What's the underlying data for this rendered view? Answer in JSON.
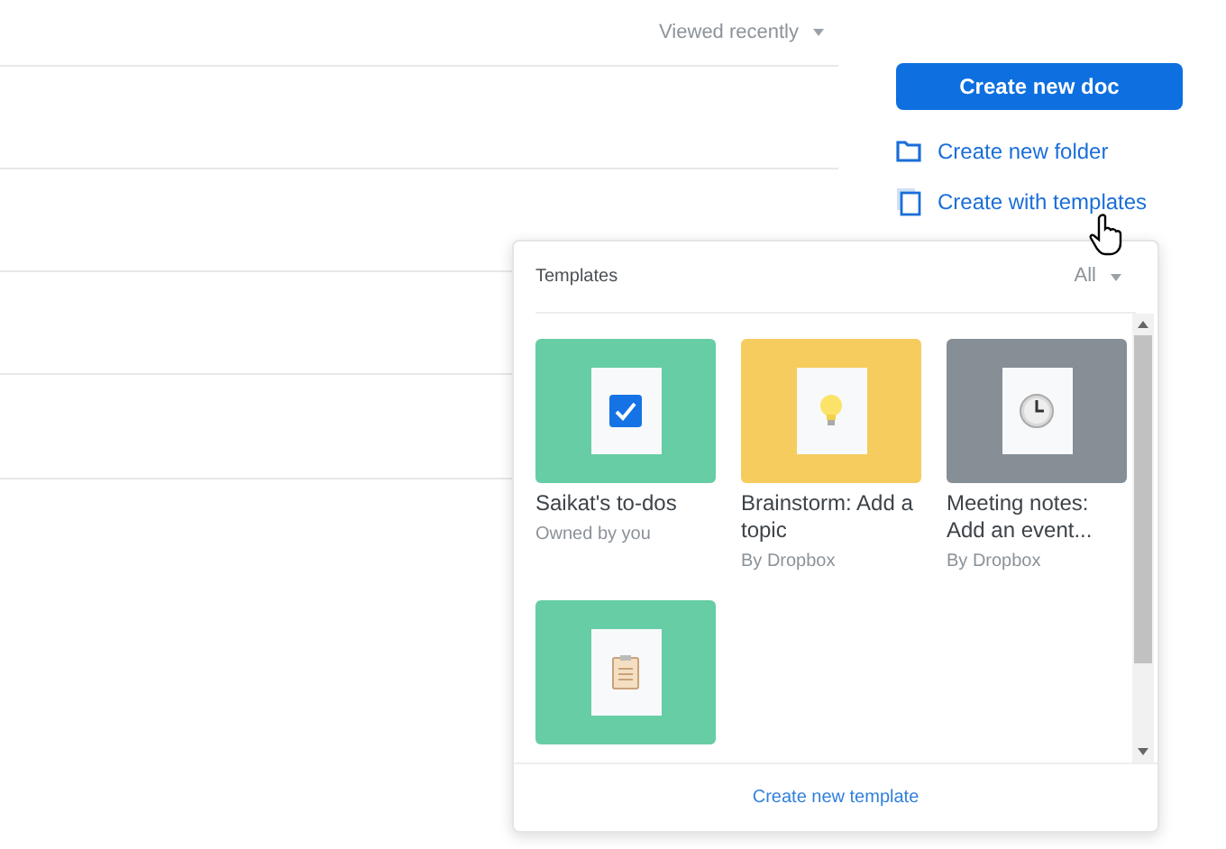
{
  "sort": {
    "label": "Viewed recently"
  },
  "actions": {
    "primary": "Create new doc",
    "links": [
      {
        "kind": "folder",
        "label": "Create new folder"
      },
      {
        "kind": "templates",
        "label": "Create with templates"
      }
    ]
  },
  "templates_menu": {
    "title": "Templates",
    "filter": "All",
    "items": [
      {
        "kind": "checkbox",
        "color": "#66cda4",
        "title": "Saikat's to-dos",
        "subtitle": "Owned by you"
      },
      {
        "kind": "bulb",
        "color": "#f6cc5f",
        "title": "Brainstorm: Add a topic",
        "subtitle": "By Dropbox"
      },
      {
        "kind": "clock",
        "color": "#868e96",
        "title": "Meeting notes: Add an event...",
        "subtitle": "By Dropbox"
      },
      {
        "kind": "clipboard",
        "color": "#66cda4"
      }
    ],
    "footer": "Create new template"
  }
}
